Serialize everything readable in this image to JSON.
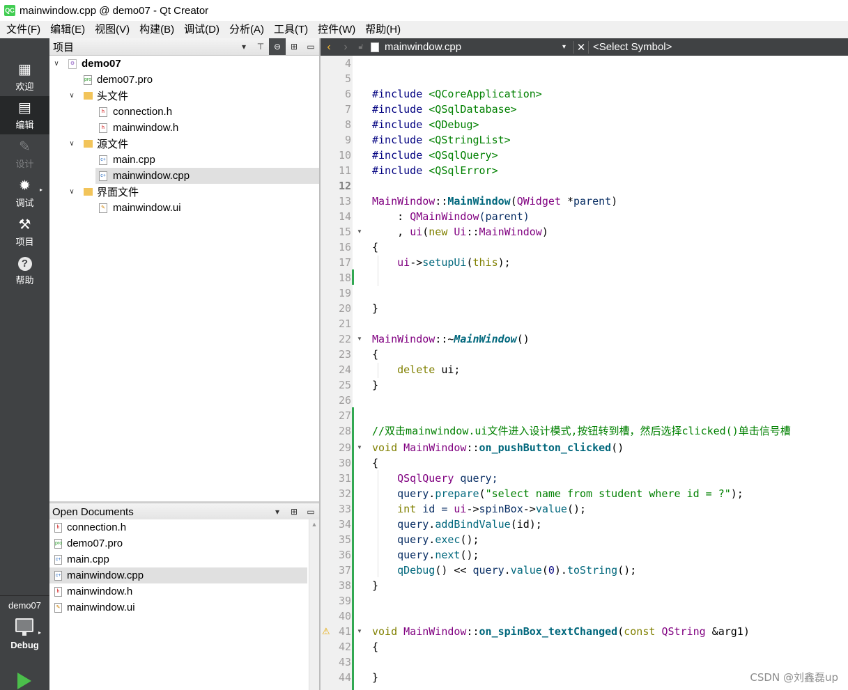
{
  "window": {
    "title": "mainwindow.cpp @ demo07 - Qt Creator",
    "app_icon": "QC"
  },
  "menu": [
    "文件(F)",
    "编辑(E)",
    "视图(V)",
    "构建(B)",
    "调试(D)",
    "分析(A)",
    "工具(T)",
    "控件(W)",
    "帮助(H)"
  ],
  "modes": [
    {
      "label": "欢迎",
      "icon": "grid-icon",
      "glyph": "▦"
    },
    {
      "label": "编辑",
      "icon": "edit-document-icon",
      "glyph": "▤"
    },
    {
      "label": "设计",
      "icon": "pencil-icon",
      "glyph": "✎"
    },
    {
      "label": "调试",
      "icon": "bug-icon",
      "glyph": "✹"
    },
    {
      "label": "项目",
      "icon": "wrench-icon",
      "glyph": "⚒"
    },
    {
      "label": "帮助",
      "icon": "help-icon",
      "glyph": "?"
    }
  ],
  "kit": {
    "project": "demo07",
    "build": "Debug"
  },
  "project_pane": {
    "title": "项目"
  },
  "tree": {
    "project": "demo07",
    "pro_file": "demo07.pro",
    "headers_folder": "头文件",
    "headers": [
      "connection.h",
      "mainwindow.h"
    ],
    "sources_folder": "源文件",
    "sources": [
      "main.cpp",
      "mainwindow.cpp"
    ],
    "forms_folder": "界面文件",
    "forms": [
      "mainwindow.ui"
    ]
  },
  "open_documents": {
    "title": "Open Documents",
    "items": [
      "connection.h",
      "demo07.pro",
      "main.cpp",
      "mainwindow.cpp",
      "mainwindow.h",
      "mainwindow.ui"
    ]
  },
  "editor": {
    "file": "mainwindow.cpp",
    "symbol": "<Select Symbol>",
    "line_numbers": [
      "4",
      "5",
      "6",
      "7",
      "8",
      "9",
      "10",
      "11",
      "12",
      "13",
      "14",
      "15",
      "16",
      "17",
      "18",
      "19",
      "20",
      "21",
      "22",
      "23",
      "24",
      "25",
      "26",
      "27",
      "28",
      "29",
      "30",
      "31",
      "32",
      "33",
      "34",
      "35",
      "36",
      "37",
      "38",
      "39",
      "40",
      "41",
      "42",
      "43",
      "44"
    ],
    "current_line": "12"
  },
  "code": {
    "l7a": "#include ",
    "l7b": "<QCoreApplication>",
    "l8a": "#include ",
    "l8b": "<QSqlDatabase>",
    "l9a": "#include ",
    "l9b": "<QDebug>",
    "l10a": "#include ",
    "l10b": "<QStringList>",
    "l11a": "#include ",
    "l11b": "<QSqlQuery>",
    "l12a": "#include ",
    "l12b": "<QSqlError>",
    "l14a": "MainWindow",
    "l14b": "::",
    "l14c": "MainWindow",
    "l14d": "(",
    "l14e": "QWidget",
    "l14f": " *",
    "l14g": "parent",
    "l14h": ")",
    "l15a": "    : ",
    "l15b": "QMainWindow",
    "l15c": "(parent)",
    "l16a": "    , ",
    "l16b": "ui",
    "l16c": "(",
    "l16d": "new ",
    "l16e": "Ui",
    "l16f": "::",
    "l16g": "MainWindow",
    "l16h": ")",
    "l17": "{",
    "l18a": "    ",
    "l18b": "ui",
    "l18c": "->",
    "l18d": "setupUi",
    "l18e": "(",
    "l18f": "this",
    "l18g": ");",
    "l21": "}",
    "l23a": "MainWindow",
    "l23b": "::~",
    "l23c": "MainWindow",
    "l23d": "()",
    "l24": "{",
    "l25a": "    ",
    "l25b": "delete ",
    "l25c": "ui;",
    "l26": "}",
    "l29": "//双击mainwindow.ui文件进入设计模式,按钮转到槽，然后选择clicked()单击信号槽",
    "l30a": "void ",
    "l30b": "MainWindow",
    "l30c": "::",
    "l30d": "on_pushButton_clicked",
    "l30e": "()",
    "l31": "{",
    "l32a": "    ",
    "l32b": "QSqlQuery",
    " l32c": "",
    "l32d": " query;",
    "l33a": "    ",
    "l33b": "query",
    ".l33c": "",
    "l33d": ".",
    "l33e": "prepare",
    "l33f": "(",
    "l33g": "\"select name from student where id = ?\"",
    "l33h": ");",
    "l34a": "    ",
    "l34b": "int ",
    "l34c": "id = ",
    "l34d": "ui",
    "l34e": "->",
    "l34f": "spinBox",
    "l34g": "->",
    "l34h": "value",
    "l34i": "();",
    "l35a": "    ",
    "l35b": "query",
    "l35c": ".",
    "l35d": "addBindValue",
    "l35e": "(id);",
    "l36a": "    ",
    "l36b": "query",
    "l36c": ".",
    "l36d": "exec",
    "l36e": "();",
    "l37a": "    ",
    "l37b": "query",
    "l37c": ".",
    "l37d": "next",
    "l37e": "();",
    "l38a": "    ",
    "l38b": "qDebug",
    "l38c": "() << ",
    "l38d": "query",
    "l38e": ".",
    "l38f": "value",
    "l38g": "(",
    "l38h": "0",
    "l38i": ").",
    "l38j": "toString",
    "l38k": "();",
    "l39": "}",
    "l42a": "void ",
    "l42b": "MainWindow",
    "l42c": "::",
    "l42d": "on_spinBox_textChanged",
    "l42e": "(",
    "l42f": "const ",
    "l42g": "QString",
    " l42h": "",
    "l42i": " &arg1)",
    "l43": "{",
    "l45": "}"
  },
  "watermark": "CSDN @刘鑫磊up",
  "colors": {
    "modebar": "#404244",
    "active_mode": "#262829",
    "keyword": "#808000",
    "string": "#008000",
    "type": "#800080",
    "function": "#00677c",
    "preprocessor": "#000080",
    "comment": "#008000",
    "change_marker": "#32a852",
    "run": "#4bbe4b"
  }
}
